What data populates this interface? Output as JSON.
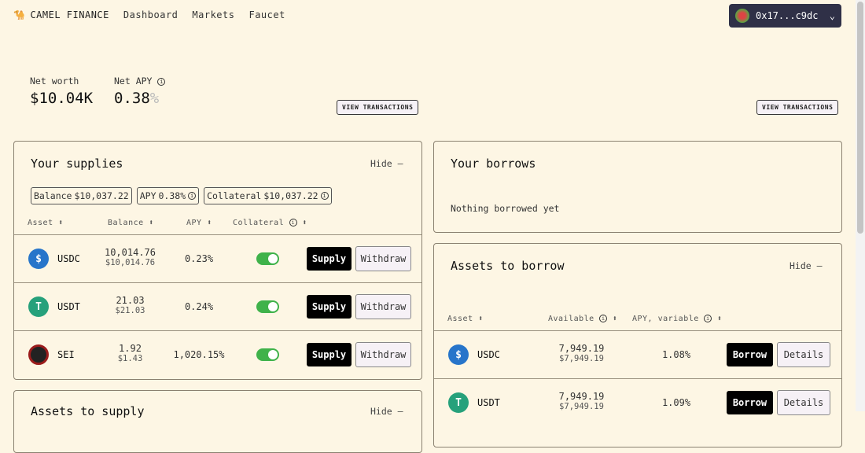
{
  "nav": {
    "brand": "CAMEL FINANCE",
    "links": [
      "Dashboard",
      "Markets",
      "Faucet"
    ]
  },
  "wallet": {
    "address": "0x17...c9dc"
  },
  "summary": {
    "net_worth_label": "Net worth",
    "net_worth": "$10.04K",
    "net_apy_label": "Net APY",
    "net_apy": "0.38",
    "pct": "%"
  },
  "view_transactions": "VIEW TRANSACTIONS",
  "supplies": {
    "title": "Your supplies",
    "hide": "Hide",
    "chips": [
      {
        "label": "Balance",
        "value": "$10,037.22"
      },
      {
        "label": "APY",
        "value": "0.38%"
      },
      {
        "label": "Collateral",
        "value": "$10,037.22"
      }
    ],
    "headers": [
      "Asset",
      "Balance",
      "APY",
      "Collateral"
    ],
    "rows": [
      {
        "asset": "USDC",
        "balance": "10,014.76",
        "usd": "$10,014.76",
        "apy": "0.23%",
        "collateral": true
      },
      {
        "asset": "USDT",
        "balance": "21.03",
        "usd": "$21.03",
        "apy": "0.24%",
        "collateral": true
      },
      {
        "asset": "SEI",
        "balance": "1.92",
        "usd": "$1.43",
        "apy": "1,020.15%",
        "collateral": true
      }
    ],
    "supply_label": "Supply",
    "withdraw_label": "Withdraw"
  },
  "assets_to_supply": {
    "title": "Assets to supply",
    "hide": "Hide"
  },
  "borrows": {
    "title": "Your borrows",
    "empty": "Nothing borrowed yet"
  },
  "assets_to_borrow": {
    "title": "Assets to borrow",
    "hide": "Hide",
    "headers": [
      "Asset",
      "Available",
      "APY, variable"
    ],
    "rows": [
      {
        "asset": "USDC",
        "available": "7,949.19",
        "usd": "$7,949.19",
        "apy": "1.08%"
      },
      {
        "asset": "USDT",
        "available": "7,949.19",
        "usd": "$7,949.19",
        "apy": "1.09%"
      }
    ],
    "borrow_label": "Borrow",
    "details_label": "Details"
  },
  "colors": {
    "background": "#fdf6e4",
    "usdc": "#2775ca",
    "usdt": "#26a17b",
    "sei": "#9b1c1c",
    "toggle": "#3fb24a"
  }
}
